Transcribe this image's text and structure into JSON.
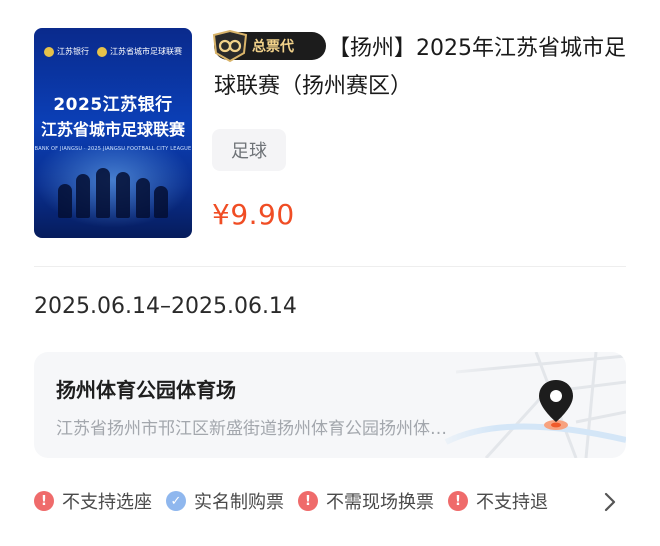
{
  "product": {
    "badge_label": "总票代",
    "title": "【扬州】2025年江苏省城市足球联赛（扬州赛区）",
    "category_tag": "足球",
    "price": "¥9.90"
  },
  "poster": {
    "bank_logo_text": "江苏银行",
    "league_logo_text": "江苏省城市足球联赛",
    "title_line1": "2025江苏银行",
    "title_line2": "江苏省城市足球联赛",
    "subtitle": "BANK OF JIANGSU · 2025 JIANGSU FOOTBALL CITY LEAGUE"
  },
  "event": {
    "date_range": "2025.06.14–2025.06.14"
  },
  "venue": {
    "name": "扬州体育公园体育场",
    "address": "江苏省扬州市邗江区新盛街道扬州体育公园扬州体…",
    "icon": "location-pin-icon"
  },
  "policies": [
    {
      "label": "不支持选座",
      "icon": "warning-icon",
      "status": "warn"
    },
    {
      "label": "实名制购票",
      "icon": "check-icon",
      "status": "ok"
    },
    {
      "label": "不需现场换票",
      "icon": "warning-icon",
      "status": "warn"
    },
    {
      "label": "不支持退",
      "icon": "warning-icon",
      "status": "warn"
    }
  ],
  "colors": {
    "price": "#f04d24",
    "warn": "#ef6b6b",
    "ok": "#8fb7ee",
    "badge_bg": "#1c1c1c",
    "badge_text": "#f2d28a"
  }
}
